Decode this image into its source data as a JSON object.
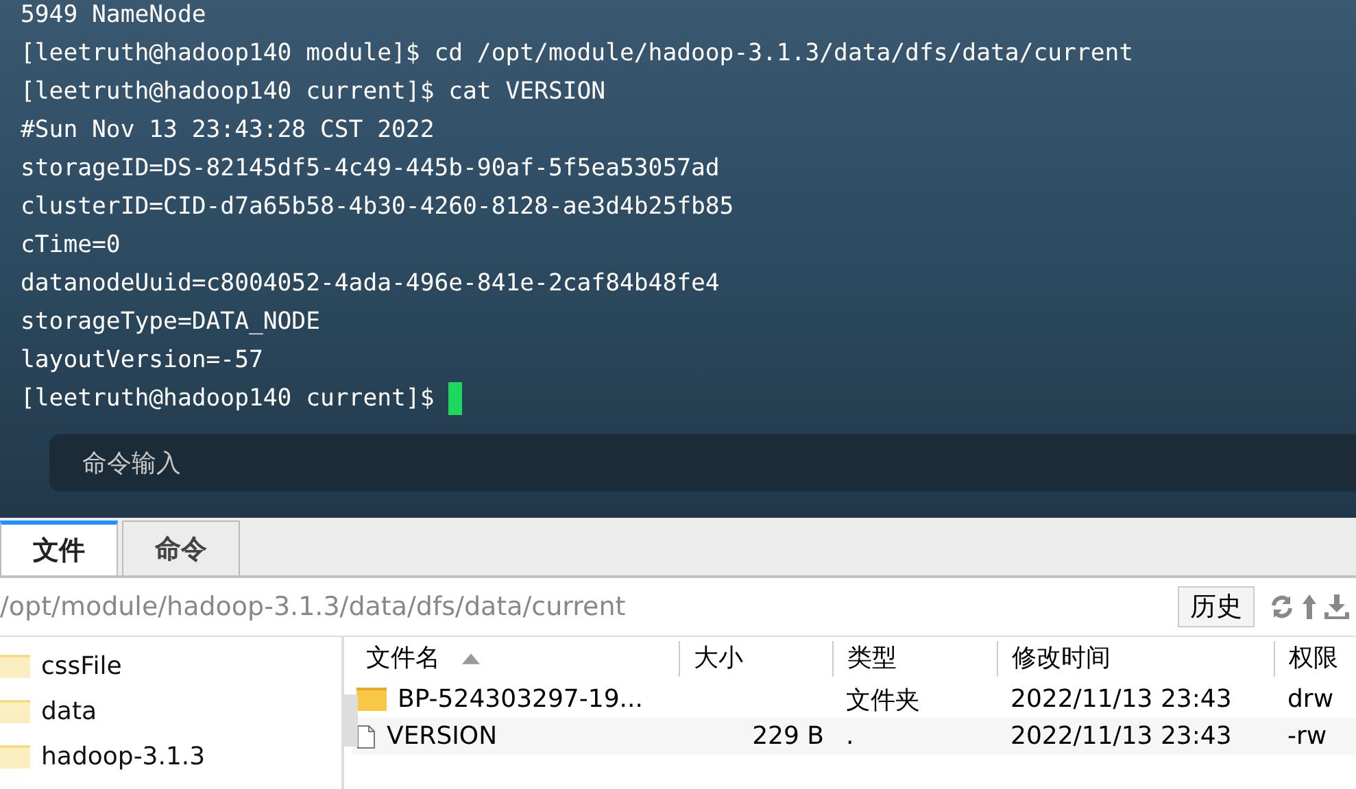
{
  "terminal": {
    "lines": [
      "5949 NameNode",
      "[leetruth@hadoop140 module]$ cd /opt/module/hadoop-3.1.3/data/dfs/data/current",
      "[leetruth@hadoop140 current]$ cat VERSION",
      "#Sun Nov 13 23:43:28 CST 2022",
      "storageID=DS-82145df5-4c49-445b-90af-5f5ea53057ad",
      "clusterID=CID-d7a65b58-4b30-4260-8128-ae3d4b25fb85",
      "cTime=0",
      "datanodeUuid=c8004052-4ada-496e-841e-2caf84b48fe4",
      "storageType=DATA_NODE",
      "layoutVersion=-57",
      "[leetruth@hadoop140 current]$ "
    ],
    "command_input": {
      "placeholder": "命令输入"
    }
  },
  "tabs": [
    {
      "label": "文件",
      "selected": true
    },
    {
      "label": "命令",
      "selected": false
    }
  ],
  "path_bar": {
    "path": "/opt/module/hadoop-3.1.3/data/dfs/data/current",
    "history_button": "历史"
  },
  "tree": {
    "items": [
      {
        "label": "cssFile"
      },
      {
        "label": "data"
      },
      {
        "label": "hadoop-3.1.3"
      }
    ]
  },
  "file_table": {
    "columns": [
      {
        "label": "文件名",
        "sorted": true
      },
      {
        "label": "大小"
      },
      {
        "label": "类型"
      },
      {
        "label": "修改时间"
      },
      {
        "label": "权限"
      }
    ],
    "rows": [
      {
        "kind": "folder",
        "name": "BP-524303297-19...",
        "size": "",
        "type": "文件夹",
        "modified": "2022/11/13 23:43",
        "permissions": "drw"
      },
      {
        "kind": "file",
        "name": "VERSION",
        "size": "229 B",
        "type": ".",
        "modified": "2022/11/13 23:43",
        "permissions": "-rw"
      }
    ]
  }
}
